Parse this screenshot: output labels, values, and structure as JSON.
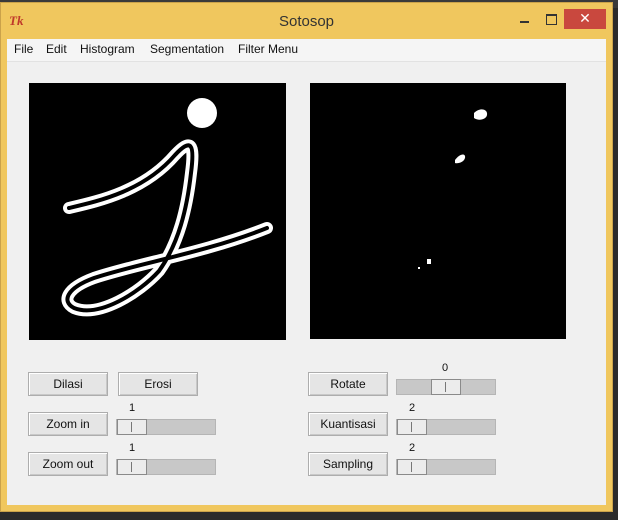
{
  "window": {
    "title": "Sotosop",
    "icon": "Tk",
    "controls": [
      "minimize",
      "maximize",
      "close"
    ]
  },
  "menu": [
    "File",
    "Edit",
    "Histogram",
    "Segmentation",
    "Filter Menu"
  ],
  "buttons": {
    "dilasi": "Dilasi",
    "erosi": "Erosi",
    "zoom_in": "Zoom in",
    "zoom_out": "Zoom out",
    "rotate": "Rotate",
    "kuantisasi": "Kuantisasi",
    "sampling": "Sampling"
  },
  "sliders": {
    "zoom_in": "1",
    "zoom_out": "1",
    "rotate": "0",
    "kuantisasi": "2",
    "sampling": "2"
  },
  "colors": {
    "titlebar": "#f0c75e",
    "close": "#c9483e",
    "canvas": "#000000"
  }
}
